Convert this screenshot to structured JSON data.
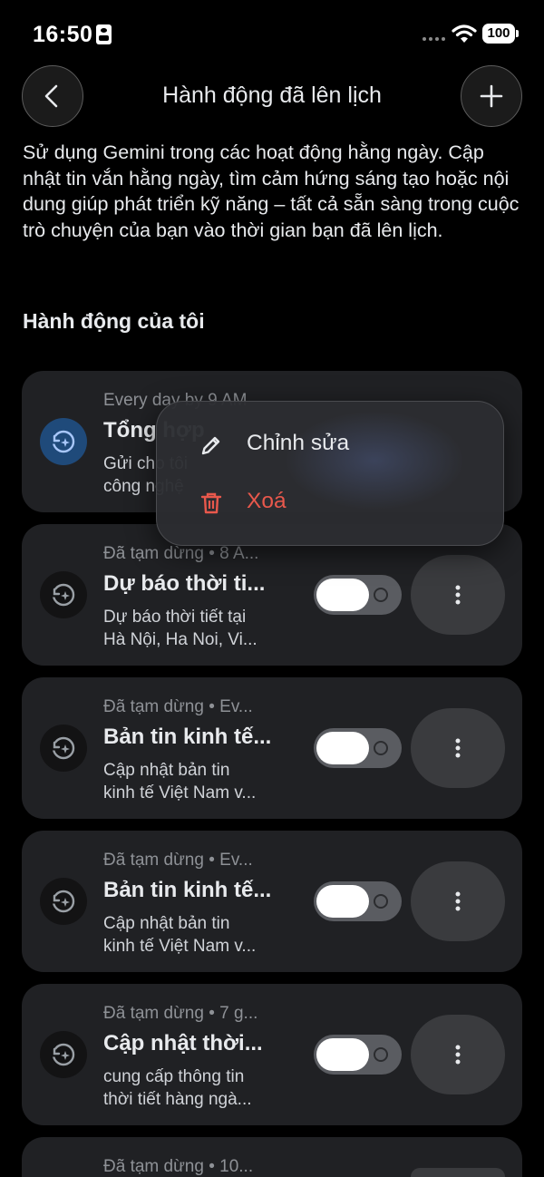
{
  "status_bar": {
    "time": "16:50",
    "battery": "100"
  },
  "header": {
    "title": "Hành động đã lên lịch"
  },
  "description": "Sử dụng Gemini trong các hoạt động hằng ngày. Cập nhật tin vắn hằng ngày, tìm cảm hứng sáng tạo hoặc nội dung giúp phát triển kỹ năng – tất cả sẵn sàng trong cuộc trò chuyện của bạn vào thời gian bạn đã lên lịch.",
  "section": {
    "title": "Hành động của tôi"
  },
  "actions": [
    {
      "meta": "Every day by 9 AM",
      "title": "Tổng hợp",
      "subtitle_line1": "Gửi cho tôi",
      "subtitle_line2": "công nghệ",
      "enabled": true
    },
    {
      "meta": "Đã tạm dừng • 8 A...",
      "title": "Dự báo thời ti...",
      "subtitle_line1": "Dự báo thời tiết tại",
      "subtitle_line2": "Hà Nội, Ha Noi, Vi...",
      "enabled": false
    },
    {
      "meta": "Đã tạm dừng • Ev...",
      "title": "Bản tin kinh tế...",
      "subtitle_line1": "Cập nhật bản tin",
      "subtitle_line2": "kinh tế Việt Nam v...",
      "enabled": false
    },
    {
      "meta": "Đã tạm dừng • Ev...",
      "title": "Bản tin kinh tế...",
      "subtitle_line1": "Cập nhật bản tin",
      "subtitle_line2": "kinh tế Việt Nam v...",
      "enabled": false
    },
    {
      "meta": "Đã tạm dừng • 7 g...",
      "title": "Cập nhật thời...",
      "subtitle_line1": "cung cấp thông tin",
      "subtitle_line2": "thời tiết hàng ngà...",
      "enabled": false
    },
    {
      "meta": "Đã tạm dừng • 10...",
      "title": "",
      "subtitle_line1": "",
      "subtitle_line2": "",
      "enabled": false
    }
  ],
  "context_menu": {
    "edit_label": "Chỉnh sửa",
    "delete_label": "Xoá"
  },
  "colors": {
    "background": "#000000",
    "card": "#202124",
    "active_icon": "#1f4a7a",
    "delete": "#e8584c"
  }
}
